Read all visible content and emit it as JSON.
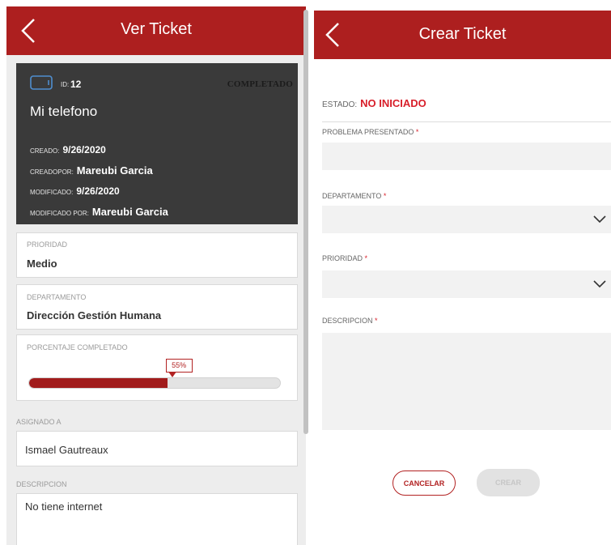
{
  "view_ticket": {
    "title": "Ver Ticket",
    "back_icon": "chevron-left-icon",
    "device_icon": "phone-icon",
    "id_label": "ID:",
    "id_value": "12",
    "status": "COMPLETADO",
    "name": "Mi telefono",
    "created_label": "CREADO:",
    "created_value": "9/26/2020",
    "created_by_label": "CREADOPOR:",
    "created_by_value": "Mareubi Garcia",
    "modified_label": "MODIFICADO:",
    "modified_value": "9/26/2020",
    "modified_by_label": "MODIFICADO POR:",
    "modified_by_value": "Mareubi Garcia",
    "priority_label": "PRIORIDAD",
    "priority_value": "Medio",
    "department_label": "DEPARTAMENTO",
    "department_value": "Dirección Gestión Humana",
    "percent_label": "PORCENTAJE COMPLETADO",
    "percent_text": "55%",
    "percent_value": 55,
    "assigned_label": "ASIGNADO A",
    "assigned_value": "Ismael Gautreaux",
    "description_label": "DESCRIPCION",
    "description_value": "No tiene internet"
  },
  "create_ticket": {
    "title": "Crear Ticket",
    "back_icon": "chevron-left-icon",
    "estado_label": "ESTADO:",
    "estado_value": "NO INICIADO",
    "problem_label": "PROBLEMA PRESENTADO",
    "department_label": "DEPARTAMENTO",
    "priority_label": "PRIORIDAD",
    "description_label": "DESCRIPCION",
    "required_mark": "*",
    "dropdown_icon": "chevron-down-icon",
    "cancel_label": "CANCELAR",
    "save_label": "CREAR"
  },
  "colors": {
    "brand_red": "#ad1f1f",
    "status_red": "#d81f2a",
    "card_dark": "#3a3a3a",
    "progress_fill": "#a11c1c"
  }
}
